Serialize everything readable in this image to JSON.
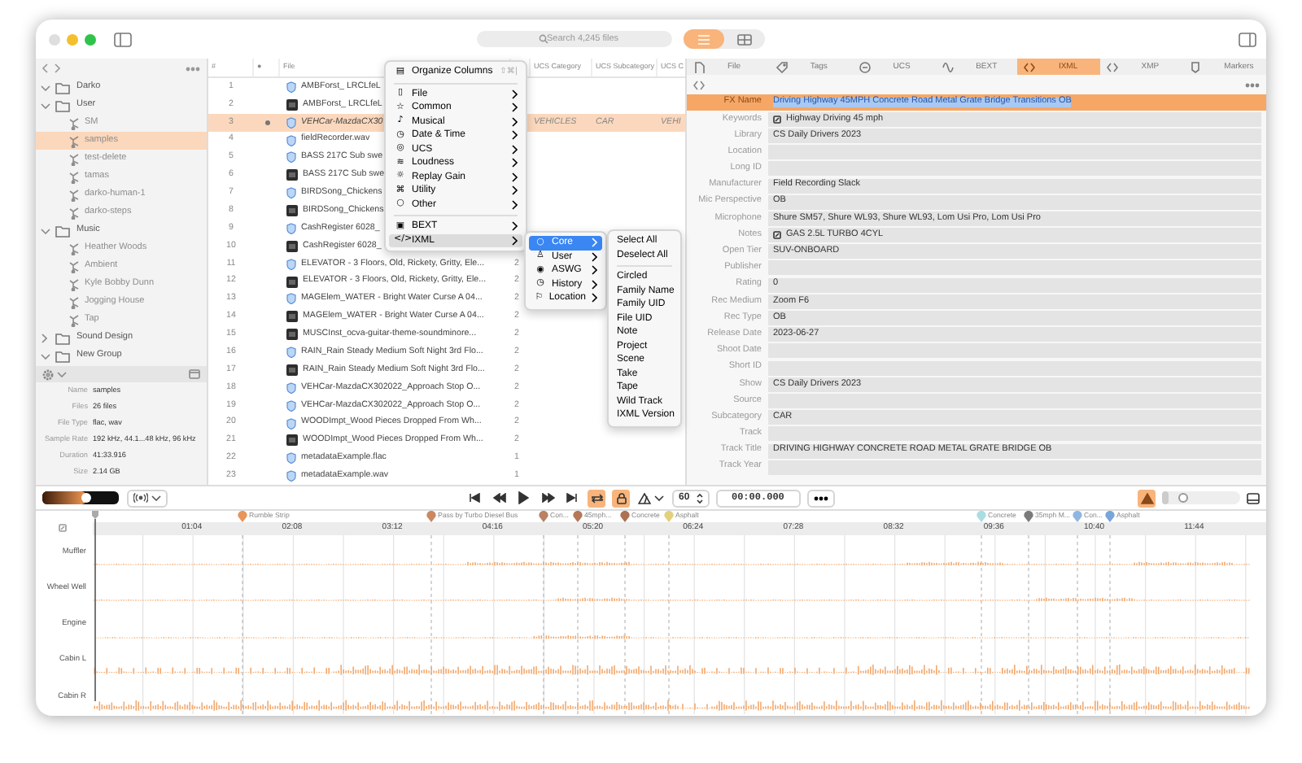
{
  "toolbar": {
    "search": {
      "placeholder": "Search 4,245 files"
    },
    "view_modes": [
      {
        "selected": true
      },
      {
        "selected": false
      }
    ]
  },
  "sidebar": {
    "tree": [
      {
        "label": "Darko",
        "kind": "folder",
        "expanded": true,
        "selected": false
      },
      {
        "label": "User",
        "kind": "folder",
        "expanded": true,
        "selected": false,
        "children": [
          {
            "label": "SM",
            "kind": "playlist",
            "selected": false
          },
          {
            "label": "samples",
            "kind": "playlist",
            "selected": true
          },
          {
            "label": "test-delete",
            "kind": "playlist",
            "selected": false
          },
          {
            "label": "tamas",
            "kind": "playlist",
            "selected": false
          },
          {
            "label": "darko-human-1",
            "kind": "playlist",
            "selected": false
          },
          {
            "label": "darko-steps",
            "kind": "playlist",
            "selected": false
          }
        ]
      },
      {
        "label": "Music",
        "kind": "folder",
        "expanded": true,
        "selected": false,
        "children": [
          {
            "label": "Heather Woods",
            "kind": "playlist",
            "selected": false
          },
          {
            "label": "Ambient",
            "kind": "playlist",
            "selected": false
          },
          {
            "label": "Kyle Bobby Dunn",
            "kind": "playlist",
            "selected": false
          },
          {
            "label": "Jogging House",
            "kind": "playlist",
            "selected": false
          },
          {
            "label": "Tap",
            "kind": "playlist",
            "selected": false
          }
        ]
      },
      {
        "label": "Sound Design",
        "kind": "folder",
        "expanded": false,
        "selected": false
      },
      {
        "label": "New Group",
        "kind": "folder",
        "expanded": true,
        "selected": false
      }
    ],
    "info": [
      {
        "label": "Name",
        "value": "samples"
      },
      {
        "label": "Files",
        "value": "26 files"
      },
      {
        "label": "File Type",
        "value": "flac, wav"
      },
      {
        "label": "Sample Rate",
        "value": "192 kHz, 44.1...48 kHz, 96 kHz"
      },
      {
        "label": "Duration",
        "value": "41:33.916"
      },
      {
        "label": "Size",
        "value": "2.14 GB"
      }
    ]
  },
  "table": {
    "columns": [
      "#",
      "●",
      "File",
      "",
      "UCS Category",
      "UCS Subcategory",
      "UCS C"
    ],
    "rows": [
      {
        "num": "1",
        "file": "AMBForst_ LRCLfeL",
        "kind": "audio",
        "selected": false,
        "marked": false
      },
      {
        "num": "2",
        "file": "AMBForst_ LRCLfeL",
        "kind": "artwork",
        "selected": false,
        "marked": false
      },
      {
        "num": "3",
        "file": "VEHCar-MazdaCX30",
        "kind": "audio",
        "selected": true,
        "marked": true,
        "ucs_category": "VEHICLES",
        "ucs_subcategory": "CAR",
        "column_7": "VEHI"
      },
      {
        "num": "4",
        "file": "fieldRecorder.wav",
        "kind": "audio",
        "selected": false,
        "marked": false
      },
      {
        "num": "5",
        "file": "BASS 217C Sub swe",
        "kind": "audio",
        "selected": false,
        "marked": false
      },
      {
        "num": "6",
        "file": "BASS 217C Sub swe",
        "kind": "artwork",
        "selected": false,
        "marked": false
      },
      {
        "num": "7",
        "file": "BIRDSong_Chickens",
        "kind": "audio",
        "selected": false,
        "marked": false
      },
      {
        "num": "8",
        "file": "BIRDSong_Chickens",
        "kind": "artwork",
        "selected": false,
        "marked": false
      },
      {
        "num": "9",
        "file": "CashRegister 6028_",
        "kind": "audio",
        "selected": false,
        "marked": false
      },
      {
        "num": "10",
        "file": "CashRegister 6028_",
        "kind": "artwork",
        "selected": false,
        "marked": false
      },
      {
        "num": "11",
        "file": "ELEVATOR - 3 Floors, Old, Rickety, Gritty, Ele...",
        "kind": "audio",
        "selected": false,
        "marked": false,
        "count": "2"
      },
      {
        "num": "12",
        "file": "ELEVATOR - 3 Floors, Old, Rickety, Gritty, Ele...",
        "kind": "artwork",
        "selected": false,
        "marked": false,
        "count": "2"
      },
      {
        "num": "13",
        "file": "MAGElem_WATER - Bright Water Curse A 04...",
        "kind": "audio",
        "selected": false,
        "marked": false,
        "count": "2"
      },
      {
        "num": "14",
        "file": "MAGElem_WATER - Bright Water Curse A 04...",
        "kind": "artwork",
        "selected": false,
        "marked": false,
        "count": "2"
      },
      {
        "num": "15",
        "file": "MUSCInst_ocva-guitar-theme-soundminore...",
        "kind": "artwork",
        "selected": false,
        "marked": false,
        "count": "2"
      },
      {
        "num": "16",
        "file": "RAIN_Rain Steady Medium Soft Night 3rd Flo...",
        "kind": "audio",
        "selected": false,
        "marked": false,
        "count": "2"
      },
      {
        "num": "17",
        "file": "RAIN_Rain Steady Medium Soft Night 3rd Flo...",
        "kind": "artwork",
        "selected": false,
        "marked": false,
        "count": "2"
      },
      {
        "num": "18",
        "file": "VEHCar-MazdaCX302022_Approach Stop O...",
        "kind": "audio",
        "selected": false,
        "marked": false,
        "count": "2"
      },
      {
        "num": "19",
        "file": "VEHCar-MazdaCX302022_Approach Stop O...",
        "kind": "audio",
        "selected": false,
        "marked": false,
        "count": "2"
      },
      {
        "num": "20",
        "file": "WOODImpt_Wood Pieces Dropped From Wh...",
        "kind": "audio",
        "selected": false,
        "marked": false,
        "count": "2"
      },
      {
        "num": "21",
        "file": "WOODImpt_Wood Pieces Dropped From Wh...",
        "kind": "artwork",
        "selected": false,
        "marked": false,
        "count": "2"
      },
      {
        "num": "22",
        "file": "metadataExample.flac",
        "kind": "audio",
        "selected": false,
        "marked": false,
        "count": "1"
      },
      {
        "num": "23",
        "file": "metadataExample.wav",
        "kind": "audio",
        "selected": false,
        "marked": false,
        "count": "1"
      }
    ]
  },
  "column_menu": {
    "items": [
      {
        "kind": "item",
        "icon": "▤",
        "label": "Organize Columns",
        "shortcut": "⇧⌘|",
        "submenu": false,
        "highlighted": false
      },
      {
        "kind": "separator"
      },
      {
        "kind": "item",
        "icon": "▯",
        "label": "File",
        "submenu": true,
        "highlighted": false
      },
      {
        "kind": "item",
        "icon": "☆",
        "label": "Common",
        "submenu": true,
        "highlighted": false
      },
      {
        "kind": "item",
        "icon": "♪",
        "label": "Musical",
        "submenu": true,
        "highlighted": false
      },
      {
        "kind": "item",
        "icon": "◷",
        "label": "Date & Time",
        "submenu": true,
        "highlighted": false
      },
      {
        "kind": "item",
        "icon": "◎",
        "label": "UCS",
        "submenu": true,
        "highlighted": false
      },
      {
        "kind": "item",
        "icon": "≋",
        "label": "Loudness",
        "submenu": true,
        "highlighted": false
      },
      {
        "kind": "item",
        "icon": "☼",
        "label": "Replay Gain",
        "submenu": true,
        "highlighted": false
      },
      {
        "kind": "item",
        "icon": "⌘",
        "label": "Utility",
        "submenu": true,
        "highlighted": false
      },
      {
        "kind": "item",
        "icon": "○",
        "label": "Other",
        "submenu": true,
        "highlighted": false
      },
      {
        "kind": "separator"
      },
      {
        "kind": "item",
        "icon": "▣",
        "label": "BEXT",
        "submenu": true,
        "highlighted": false
      },
      {
        "kind": "item",
        "icon": "</>",
        "label": "IXML",
        "submenu": true,
        "highlighted": true
      }
    ]
  },
  "ixml_menu": {
    "items": [
      {
        "kind": "item",
        "icon": "○",
        "label": "Core",
        "submenu": true,
        "highlighted": true
      },
      {
        "kind": "item",
        "icon": "♙",
        "label": "User",
        "submenu": true,
        "highlighted": false
      },
      {
        "kind": "item",
        "icon": "◉",
        "label": "ASWG",
        "submenu": true,
        "highlighted": false
      },
      {
        "kind": "item",
        "icon": "◷",
        "label": "History",
        "submenu": true,
        "highlighted": false
      },
      {
        "kind": "item",
        "icon": "⚐",
        "label": "Location",
        "submenu": true,
        "highlighted": false
      }
    ]
  },
  "core_menu": {
    "items": [
      {
        "kind": "item",
        "label": "Select All"
      },
      {
        "kind": "item",
        "label": "Deselect All"
      },
      {
        "kind": "separator"
      },
      {
        "kind": "item",
        "label": "Circled"
      },
      {
        "kind": "item",
        "label": "Family Name"
      },
      {
        "kind": "item",
        "label": "Family UID"
      },
      {
        "kind": "item",
        "label": "File UID"
      },
      {
        "kind": "item",
        "label": "Note"
      },
      {
        "kind": "item",
        "label": "Project"
      },
      {
        "kind": "item",
        "label": "Scene"
      },
      {
        "kind": "item",
        "label": "Take"
      },
      {
        "kind": "item",
        "label": "Tape"
      },
      {
        "kind": "item",
        "label": "Wild Track"
      },
      {
        "kind": "item",
        "label": "IXML Version"
      }
    ]
  },
  "inspector": {
    "tabs": [
      {
        "label": "File",
        "selected": false
      },
      {
        "label": "Tags",
        "selected": false
      },
      {
        "label": "UCS",
        "selected": false
      },
      {
        "label": "BEXT",
        "selected": false
      },
      {
        "label": "IXML",
        "selected": true
      },
      {
        "label": "XMP",
        "selected": false
      },
      {
        "label": "Markers",
        "selected": false
      }
    ],
    "fields": [
      {
        "label": "FX Name",
        "value": "Driving Highway 45MPH Concrete Road Metal Grate Bridge Transitions OB",
        "selected": true,
        "kind": "text"
      },
      {
        "label": "Keywords",
        "value": "Highway Driving 45 mph",
        "selected": false,
        "kind": "linked"
      },
      {
        "label": "Library",
        "value": "CS Daily Drivers 2023",
        "selected": false,
        "kind": "text"
      },
      {
        "label": "Location",
        "selected": false,
        "kind": "text"
      },
      {
        "label": "Long ID",
        "selected": false,
        "kind": "text"
      },
      {
        "label": "Manufacturer",
        "value": "Field Recording Slack",
        "selected": false,
        "kind": "text"
      },
      {
        "label": "Mic Perspective",
        "value": "OB",
        "selected": false,
        "kind": "text"
      },
      {
        "label": "Microphone",
        "value": "Shure SM57, Shure WL93, Shure WL93, Lom Usi Pro, Lom Usi Pro",
        "selected": false,
        "kind": "text"
      },
      {
        "label": "Notes",
        "value": "GAS 2.5L TURBO 4CYL",
        "selected": false,
        "kind": "linked"
      },
      {
        "label": "Open Tier",
        "value": "SUV-ONBOARD",
        "selected": false,
        "kind": "text"
      },
      {
        "label": "Publisher",
        "selected": false,
        "kind": "text"
      },
      {
        "label": "Rating",
        "value": "0",
        "selected": false,
        "kind": "text"
      },
      {
        "label": "Rec Medium",
        "value": "Zoom F6",
        "selected": false,
        "kind": "text"
      },
      {
        "label": "Rec Type",
        "value": "OB",
        "selected": false,
        "kind": "text"
      },
      {
        "label": "Release Date",
        "value": "2023-06-27",
        "selected": false,
        "kind": "text"
      },
      {
        "label": "Shoot Date",
        "selected": false,
        "kind": "text"
      },
      {
        "label": "Short ID",
        "selected": false,
        "kind": "text"
      },
      {
        "label": "Show",
        "value": "CS Daily Drivers 2023",
        "selected": false,
        "kind": "text"
      },
      {
        "label": "Source",
        "selected": false,
        "kind": "text"
      },
      {
        "label": "Subcategory",
        "value": "CAR",
        "selected": false,
        "kind": "text"
      },
      {
        "label": "Track",
        "selected": false,
        "kind": "text"
      },
      {
        "label": "Track Title",
        "value": "DRIVING HIGHWAY CONCRETE ROAD METAL GRATE BRIDGE OB",
        "selected": false,
        "kind": "text"
      },
      {
        "label": "Track Year",
        "selected": false,
        "kind": "text"
      }
    ]
  },
  "transport": {
    "volume": {
      "level": 0.58
    },
    "loop": {
      "on": true
    },
    "lock": {
      "on": true
    },
    "tempo": "60",
    "time": "00:00.000",
    "tool": {
      "on": true
    },
    "zoom": {
      "level": 0.08
    }
  },
  "timeline": {
    "ruler": [
      "01:04",
      "02:08",
      "03:12",
      "04:16",
      "05:20",
      "06:24",
      "07:28",
      "08:32",
      "09:36",
      "10:40",
      "11:44"
    ],
    "markers": [
      {
        "label": "Rumble Strip",
        "color": "#e8955a"
      },
      {
        "label": "Pass by Turbo Diesel Bus",
        "color": "#c98862"
      },
      {
        "label": "Con...",
        "color": "#b98263"
      },
      {
        "label": "45mph...",
        "color": "#b47858"
      },
      {
        "label": "Concrete",
        "color": "#ad7254"
      },
      {
        "label": "Asphalt",
        "color": "#e3d07c"
      },
      {
        "label": "Concrete",
        "color": "#a9dde2"
      },
      {
        "label": "35mph M...",
        "color": "#7a7a7a"
      },
      {
        "label": "Con...",
        "color": "#8fb5e2"
      },
      {
        "label": "Asphalt",
        "color": "#78a5dc"
      }
    ],
    "tracks": [
      "Muffler",
      "Wheel Well",
      "Engine",
      "Cabin L",
      "Cabin R"
    ]
  }
}
